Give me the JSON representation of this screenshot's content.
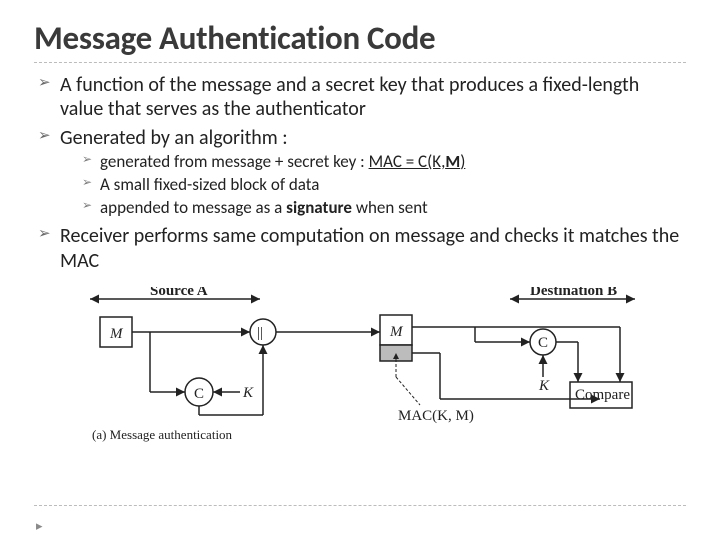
{
  "title": "Message Authentication Code",
  "bullets": {
    "b1": "A function of the message and a secret key that produces a fixed-length value that serves as the authenticator",
    "b2": "Generated by an algorithm :",
    "s1_pre": "generated from message + secret key : ",
    "s1_mid": "MAC = C(K,",
    "s1_inner": "M",
    "s1_post": ")",
    "s2": "A small fixed-sized block of data",
    "s3_pre": "appended to message as a ",
    "s3_b": "signature",
    "s3_post": " when sent",
    "b3": "Receiver performs same computation on message and checks it matches the MAC"
  },
  "diagram": {
    "sourceA": "Source A",
    "destB": "Destination B",
    "M": "M",
    "K": "K",
    "C": "C",
    "concat": "||",
    "compare": "Compare",
    "macKM": "MAC(K, M)",
    "caption": "(a) Message authentication"
  }
}
